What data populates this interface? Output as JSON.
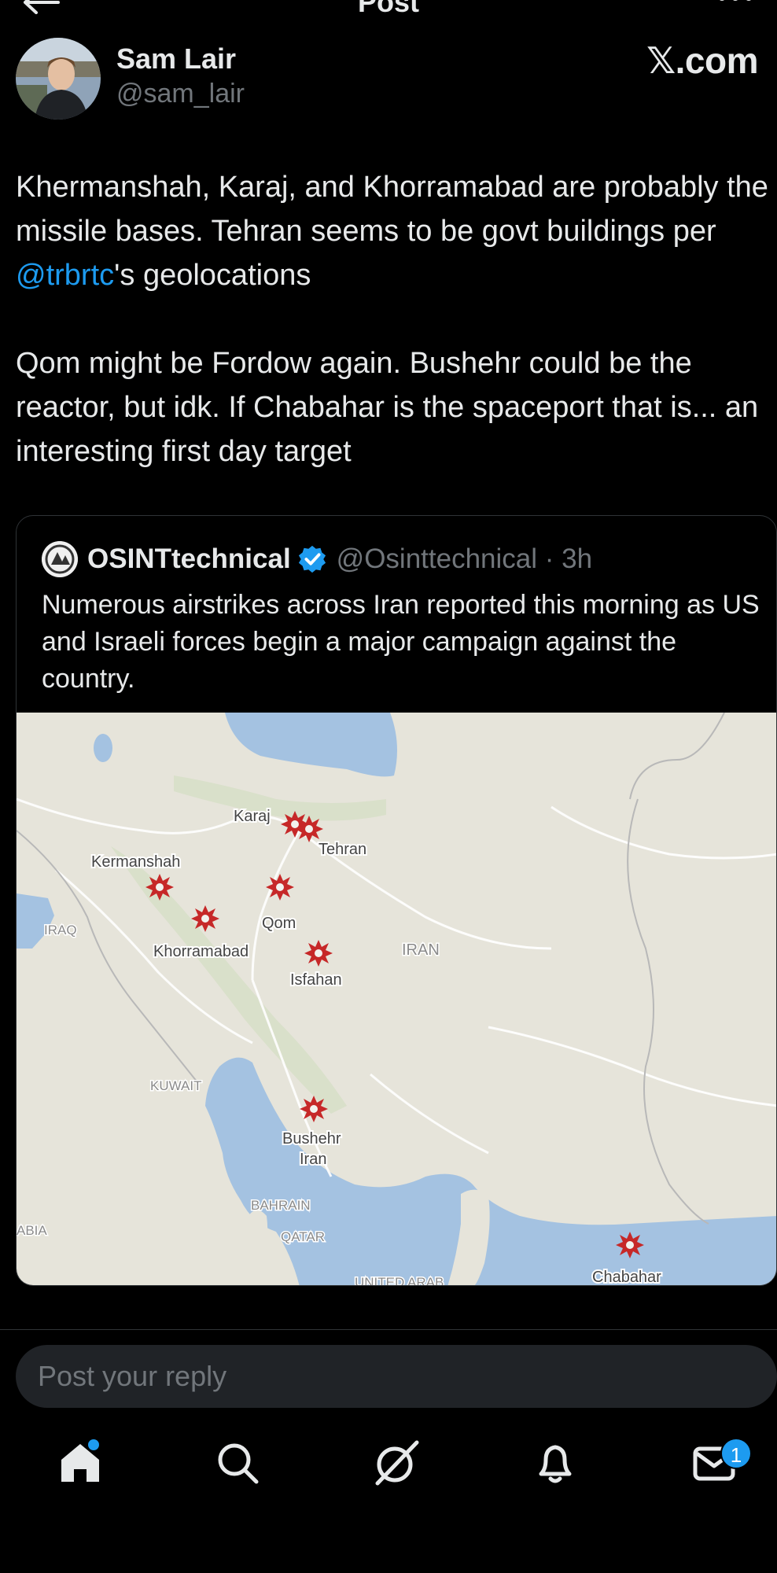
{
  "nav": {
    "title": "Post"
  },
  "author": {
    "name": "Sam Lair",
    "handle": "@sam_lair",
    "source": "𝕏.com"
  },
  "post": {
    "p1_a": "Khermanshah, Karaj, and Khorramabad are probably the missile bases. Tehran seems to be govt buildings per ",
    "mention": "@trbrtc",
    "p1_b": "'s geolocations",
    "p2": "Qom might be Fordow again. Bushehr could be the reactor, but idk. If Chabahar is the spaceport that is... an interesting first day target"
  },
  "quote": {
    "name": "OSINTtechnical",
    "handle_time": "@Osinttechnical · 3h",
    "text": "Numerous airstrikes across Iran reported this morning as US and Israeli forces begin a major campaign against the country.",
    "map": {
      "labels": {
        "karaj": "Karaj",
        "tehran": "Tehran",
        "kermanshah": "Kermanshah",
        "qom": "Qom",
        "khorramabad": "Khorramabad",
        "iraq": "IRAQ",
        "iran": "IRAN",
        "isfahan": "Isfahan",
        "kuwait": "KUWAIT",
        "bushehr1": "Bushehr",
        "bushehr2": "Iran",
        "bahrain": "BAHRAIN",
        "qatar": "QATAR",
        "abia": "ABIA",
        "chabahar": "Chabahar",
        "uae": "UNITED ARAB"
      }
    }
  },
  "reply": {
    "placeholder": "Post your reply"
  },
  "tabs": {
    "home": "home-icon",
    "search": "search-icon",
    "grok": "grok-icon",
    "notifications": "bell-icon",
    "messages": "mail-icon",
    "messages_badge": "1"
  },
  "colors": {
    "accent": "#1d9bf0",
    "background": "#000000",
    "text": "#e7e9ea",
    "muted": "#71767b",
    "strike": "#c62828"
  }
}
